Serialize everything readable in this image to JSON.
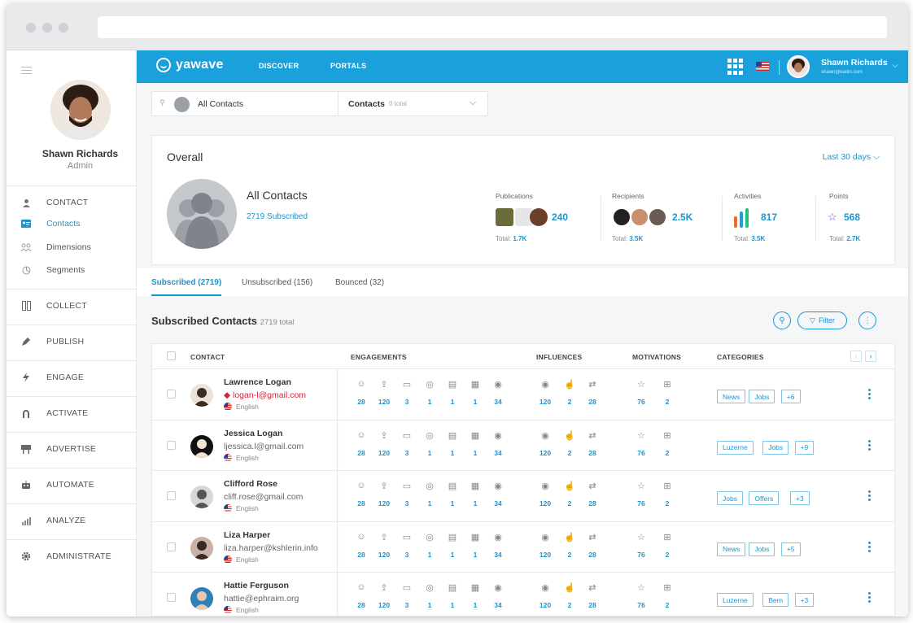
{
  "app": {
    "brand": "yawave",
    "accent": "#1aa0db"
  },
  "topnav": {
    "discover": "DISCOVER",
    "portals": "PORTALS"
  },
  "user": {
    "name": "Shawn Richards",
    "email": "shawn@kadin.com",
    "role": "Admin"
  },
  "sidebar": {
    "contact": "CONTACT",
    "contacts": "Contacts",
    "dimensions": "Dimensions",
    "segments": "Segments",
    "collect": "COLLECT",
    "publish": "PUBLISH",
    "engage": "ENGAGE",
    "activate": "ACTIVATE",
    "advertise": "ADVERTISE",
    "automate": "AUTOMATE",
    "analyze": "ANALYZE",
    "administrate": "ADMINISTRATE"
  },
  "search": {
    "value": "All Contacts",
    "dropdown_label": "Contacts",
    "dropdown_count": "0 total"
  },
  "overall": {
    "title": "Overall",
    "period": "Last 30 days",
    "group_name": "All Contacts",
    "subscribed": "2719 Subscribed",
    "stats": {
      "publications": {
        "label": "Publications",
        "value": "240",
        "total_label": "Total:",
        "total": "1.7K"
      },
      "recipients": {
        "label": "Recipients",
        "value": "2.5K",
        "total_label": "Total:",
        "total": "3.5K"
      },
      "activities": {
        "label": "Activities",
        "value": "817",
        "total_label": "Total:",
        "total": "3.5K"
      },
      "points": {
        "label": "Points",
        "value": "568",
        "total_label": "Total:",
        "total": "2.7K"
      }
    }
  },
  "tabs": {
    "subscribed": "Subscribed (2719)",
    "unsubscribed": "Unsubscribed (156)",
    "bounced": "Bounced (32)"
  },
  "list": {
    "title": "Subscribed Contacts",
    "total": "2719 total",
    "filter": "Filter"
  },
  "columns": {
    "contact": "CONTACT",
    "engagements": "ENGAGEMENTS",
    "influences": "INFLUENCES",
    "motivations": "MOTIVATIONS",
    "categories": "CATEGORIES"
  },
  "rows": [
    {
      "name": "Lawrence Logan",
      "email": "logan-l@gmail.com",
      "lang": "English",
      "eng": [
        "28",
        "120",
        "3",
        "1",
        "1",
        "1",
        "34"
      ],
      "inf": [
        "120",
        "2",
        "28"
      ],
      "mot": [
        "76",
        "2"
      ],
      "tags": [
        "News",
        "Jobs",
        "+6"
      ]
    },
    {
      "name": "Jessica Logan",
      "email": "ljessica.l@gmail.com",
      "lang": "English",
      "eng": [
        "28",
        "120",
        "3",
        "1",
        "1",
        "1",
        "34"
      ],
      "inf": [
        "120",
        "2",
        "28"
      ],
      "mot": [
        "76",
        "2"
      ],
      "tags": [
        "Luzerne",
        "Jobs",
        "+9"
      ]
    },
    {
      "name": "Clifford Rose",
      "email": "cliff.rose@gmail.com",
      "lang": "English",
      "eng": [
        "28",
        "120",
        "3",
        "1",
        "1",
        "1",
        "34"
      ],
      "inf": [
        "120",
        "2",
        "28"
      ],
      "mot": [
        "76",
        "2"
      ],
      "tags": [
        "Jobs",
        "Offers",
        "+3"
      ]
    },
    {
      "name": "Liza Harper",
      "email": "liza.harper@kshlerin.info",
      "lang": "English",
      "eng": [
        "28",
        "120",
        "3",
        "1",
        "1",
        "1",
        "34"
      ],
      "inf": [
        "120",
        "2",
        "28"
      ],
      "mot": [
        "76",
        "2"
      ],
      "tags": [
        "News",
        "Jobs",
        "+5"
      ]
    },
    {
      "name": "Hattie Ferguson",
      "email": "hattie@ephraim.org",
      "lang": "English",
      "eng": [
        "28",
        "120",
        "3",
        "1",
        "1",
        "1",
        "34"
      ],
      "inf": [
        "120",
        "2",
        "28"
      ],
      "mot": [
        "76",
        "2"
      ],
      "tags": [
        "Luzerne",
        "Bern",
        "+3"
      ]
    }
  ]
}
